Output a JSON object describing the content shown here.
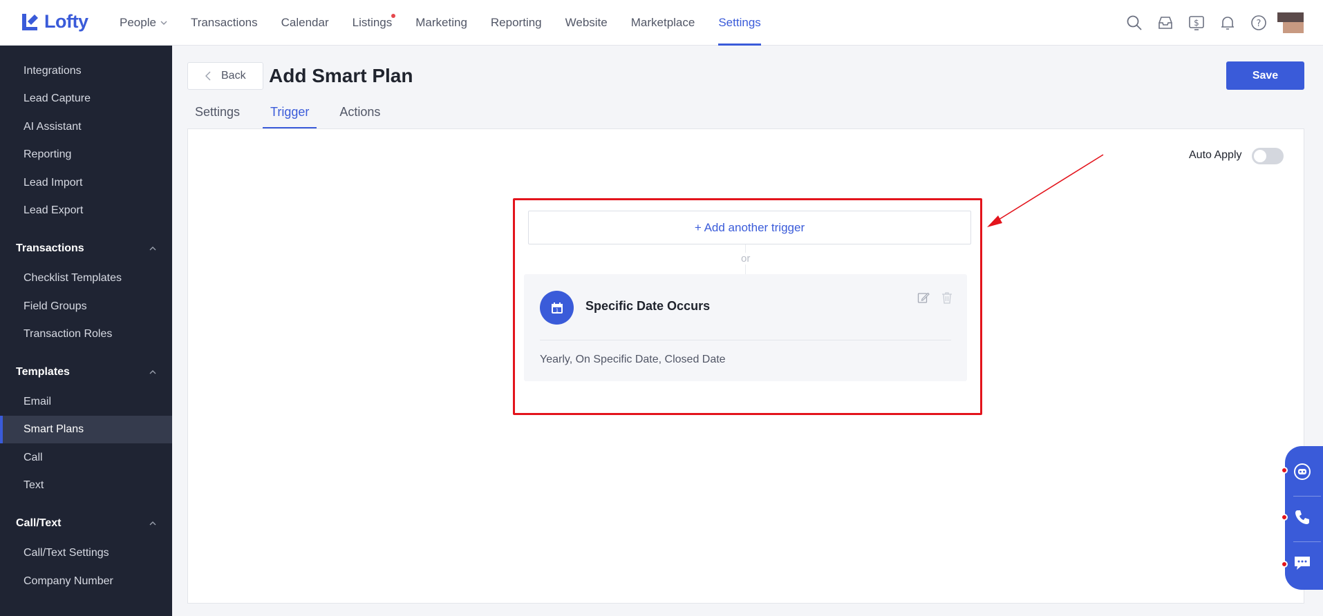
{
  "app": {
    "logo_text": "Lofty",
    "brand_color": "#3a5bd9"
  },
  "nav": {
    "items": [
      {
        "label": "People",
        "has_dropdown": true
      },
      {
        "label": "Transactions"
      },
      {
        "label": "Calendar"
      },
      {
        "label": "Listings",
        "has_dot": true
      },
      {
        "label": "Marketing"
      },
      {
        "label": "Reporting"
      },
      {
        "label": "Website"
      },
      {
        "label": "Marketplace"
      },
      {
        "label": "Settings",
        "active": true
      }
    ],
    "icons": [
      "search-icon",
      "inbox-icon",
      "billing-icon",
      "bell-icon",
      "help-icon"
    ]
  },
  "sidebar": {
    "items": [
      {
        "label": "Integrations"
      },
      {
        "label": "Lead Capture"
      },
      {
        "label": "AI Assistant"
      },
      {
        "label": "Reporting"
      },
      {
        "label": "Lead Import"
      },
      {
        "label": "Lead Export"
      }
    ],
    "groups": [
      {
        "label": "Transactions",
        "items": [
          {
            "label": "Checklist Templates"
          },
          {
            "label": "Field Groups"
          },
          {
            "label": "Transaction Roles"
          }
        ]
      },
      {
        "label": "Templates",
        "items": [
          {
            "label": "Email"
          },
          {
            "label": "Smart Plans",
            "active": true
          },
          {
            "label": "Call"
          },
          {
            "label": "Text"
          }
        ]
      },
      {
        "label": "Call/Text",
        "items": [
          {
            "label": "Call/Text Settings"
          },
          {
            "label": "Company Number"
          }
        ]
      }
    ]
  },
  "page": {
    "back_label": "Back",
    "title": "Add Smart Plan",
    "save_label": "Save",
    "tabs": [
      {
        "label": "Settings"
      },
      {
        "label": "Trigger",
        "active": true
      },
      {
        "label": "Actions"
      }
    ],
    "auto_apply_label": "Auto Apply",
    "auto_apply_on": false
  },
  "trigger": {
    "add_label": "+ Add another trigger",
    "or_label": "or",
    "card": {
      "title": "Specific Date Occurs",
      "description": "Yearly, On Specific Date, Closed Date",
      "icon": "calendar-icon"
    }
  },
  "annotation": {
    "highlight_color": "#e3141c"
  },
  "floating_bar": {
    "icons": [
      "chat-bot-icon",
      "phone-icon",
      "message-icon"
    ]
  }
}
